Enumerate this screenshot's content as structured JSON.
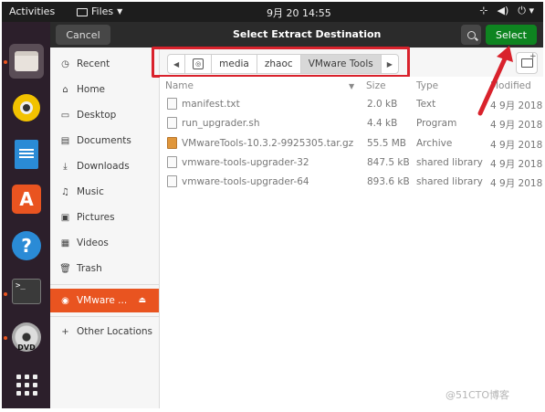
{
  "topbar": {
    "activities": "Activities",
    "app_menu": "Files",
    "clock": "9月 20  14:55",
    "tray": [
      "network-icon",
      "volume-icon",
      "power-icon"
    ]
  },
  "dock": {
    "items": [
      "files",
      "rhythmbox",
      "libreoffice-writer",
      "ubuntu-software",
      "help",
      "terminal",
      "dvd",
      "show-applications"
    ]
  },
  "dialog": {
    "cancel_label": "Cancel",
    "title": "Select Extract Destination",
    "select_label": "Select"
  },
  "sidebar": {
    "items": [
      {
        "label": "Recent",
        "icon": "clock-icon"
      },
      {
        "label": "Home",
        "icon": "home-icon"
      },
      {
        "label": "Desktop",
        "icon": "desktop-icon"
      },
      {
        "label": "Documents",
        "icon": "documents-icon"
      },
      {
        "label": "Downloads",
        "icon": "downloads-icon"
      },
      {
        "label": "Music",
        "icon": "music-icon"
      },
      {
        "label": "Pictures",
        "icon": "pictures-icon"
      },
      {
        "label": "Videos",
        "icon": "videos-icon"
      },
      {
        "label": "Trash",
        "icon": "trash-icon"
      }
    ],
    "mounted": {
      "label": "VMware ...",
      "icon": "drive-icon"
    },
    "other": {
      "label": "Other Locations",
      "icon": "plus-icon"
    }
  },
  "pathbar": {
    "segments": [
      "media",
      "zhaoc",
      "VMware Tools"
    ]
  },
  "columns": {
    "name": "Name",
    "size": "Size",
    "type": "Type",
    "modified": "Modified"
  },
  "files": [
    {
      "name": "manifest.txt",
      "size": "2.0 kB",
      "type": "Text",
      "modified": "4 9月 2018"
    },
    {
      "name": "run_upgrader.sh",
      "size": "4.4 kB",
      "type": "Program",
      "modified": "4 9月 2018"
    },
    {
      "name": "VMwareTools-10.3.2-9925305.tar.gz",
      "size": "55.5 MB",
      "type": "Archive",
      "modified": "4 9月 2018"
    },
    {
      "name": "vmware-tools-upgrader-32",
      "size": "847.5 kB",
      "type": "shared library",
      "modified": "4 9月 2018"
    },
    {
      "name": "vmware-tools-upgrader-64",
      "size": "893.6 kB",
      "type": "shared library",
      "modified": "4 9月 2018"
    }
  ],
  "watermark": "@51CTO博客",
  "colors": {
    "accent": "#e95420",
    "select": "#0e8420",
    "annotation": "#d9222c"
  }
}
